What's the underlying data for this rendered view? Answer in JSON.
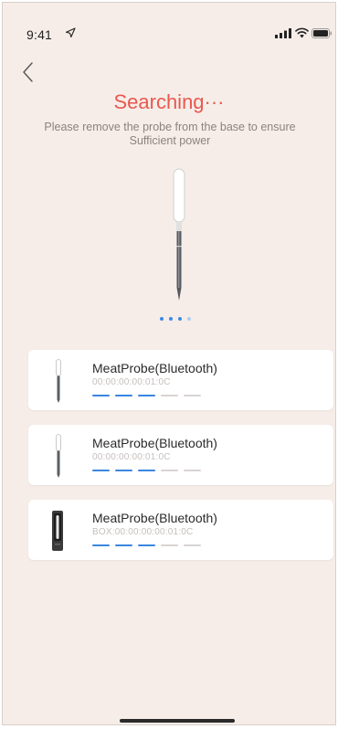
{
  "status_bar": {
    "time": "9:41",
    "icons": [
      "location-arrow-icon",
      "cellular-signal-icon",
      "wifi-icon",
      "battery-icon"
    ]
  },
  "nav": {
    "back_icon": "chevron-left-icon"
  },
  "header": {
    "title": "Searching···",
    "subtitle": "Please remove the probe from the base to ensure Sufficient power"
  },
  "pager": {
    "total": 4,
    "active_dots": 3
  },
  "devices": [
    {
      "name": "MeatProbe(Bluetooth)",
      "id": "00:00:00:00:01:0C",
      "icon": "probe-icon",
      "signal_level": 3,
      "signal_max": 5
    },
    {
      "name": "MeatProbe(Bluetooth)",
      "id": "00:00:00:00:01:0C",
      "icon": "probe-icon",
      "signal_level": 3,
      "signal_max": 5
    },
    {
      "name": "MeatProbe(Bluetooth)",
      "id": "BOX:00:00:00:00:01:0C",
      "icon": "probe-box-icon",
      "signal_level": 3,
      "signal_max": 5
    }
  ],
  "colors": {
    "background": "#f6ede8",
    "title": "#e8584f",
    "signal_active": "#3a86e0",
    "signal_inactive": "#d8d4d2"
  }
}
